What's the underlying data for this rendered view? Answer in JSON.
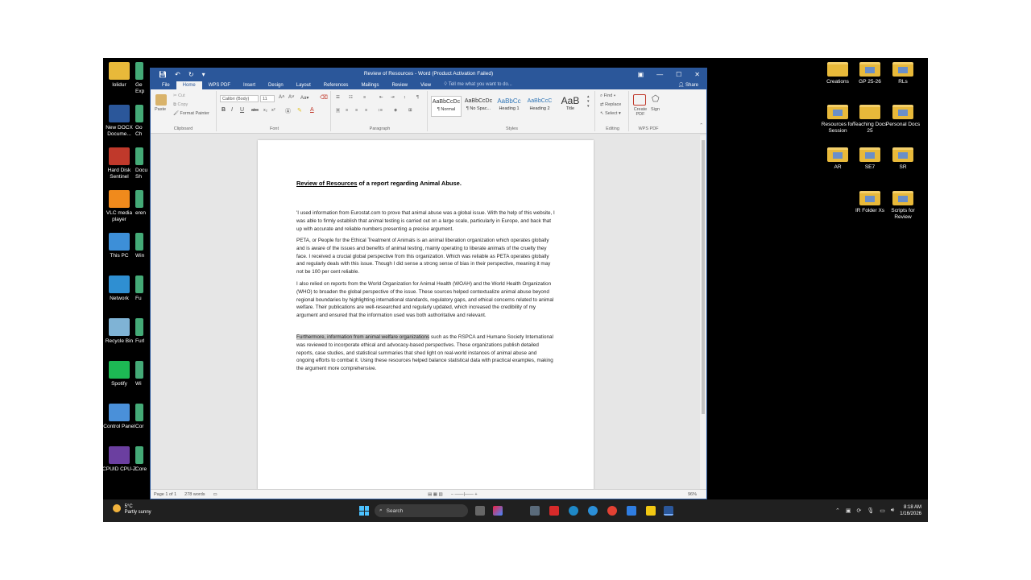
{
  "desktop_left": [
    {
      "label": "lolidur",
      "color": "#e8b93a"
    },
    {
      "label": "New DOCX Docume...",
      "color": "#2b579a"
    },
    {
      "label": "Hard Disk Sentinel",
      "color": "#c0392b"
    },
    {
      "label": "VLC media player",
      "color": "#f08a1c"
    },
    {
      "label": "This PC",
      "color": "#3d8fd8"
    },
    {
      "label": "Network",
      "color": "#2f8fd2"
    },
    {
      "label": "Recycle Bin",
      "color": "#7fb3d5"
    },
    {
      "label": "Spotify",
      "color": "#1db954"
    },
    {
      "label": "Control Panel",
      "color": "#4a90d9"
    },
    {
      "label": "CPUID CPU-Z",
      "color": "#6b3fa0"
    }
  ],
  "desktop_left_partial": [
    "Ge Exp",
    "Go Ch",
    "Docu Sh",
    "eren",
    "Win",
    "Fu",
    "Furl",
    "Wi",
    "Cor",
    "Core"
  ],
  "desktop_right": [
    {
      "label": "Creations",
      "type": "folder"
    },
    {
      "label": "GP 25-26",
      "type": "folder-doc"
    },
    {
      "label": "RLs",
      "type": "folder-doc"
    },
    {
      "label": "Resources for Session",
      "type": "folder-doc"
    },
    {
      "label": "Teaching Docs 25",
      "type": "folder"
    },
    {
      "label": "Personal Docs",
      "type": "folder-doc"
    },
    {
      "label": "AR",
      "type": "folder-doc"
    },
    {
      "label": "SE7",
      "type": "folder-doc"
    },
    {
      "label": "SR",
      "type": "folder-doc"
    },
    {
      "label": "IR Folder Xs",
      "type": "folder-doc"
    },
    {
      "label": "Scripts for Review",
      "type": "folder-doc"
    }
  ],
  "window": {
    "title": "Review of Resources - Word (Product Activation Failed)",
    "tabs": [
      "File",
      "Home",
      "WPS PDF",
      "Insert",
      "Design",
      "Layout",
      "References",
      "Mailings",
      "Review",
      "View"
    ],
    "tell_me": "Tell me what you want to do...",
    "share": "Share"
  },
  "ribbon": {
    "clipboard": {
      "label": "Clipboard",
      "paste": "Paste",
      "cut": "Cut",
      "copy": "Copy",
      "format_painter": "Format Painter"
    },
    "font": {
      "label": "Font",
      "family": "Calibri (Body)",
      "size": "11"
    },
    "paragraph": {
      "label": "Paragraph"
    },
    "styles": {
      "label": "Styles",
      "items": [
        {
          "sample": "AaBbCcDc",
          "name": "¶ Normal"
        },
        {
          "sample": "AaBbCcDc",
          "name": "¶ No Spac..."
        },
        {
          "sample": "AaBbCc",
          "name": "Heading 1"
        },
        {
          "sample": "AaBbCcC",
          "name": "Heading 2"
        },
        {
          "sample": "AaB",
          "name": "Title"
        }
      ]
    },
    "editing": {
      "label": "Editing",
      "find": "Find",
      "replace": "Replace",
      "select": "Select"
    },
    "wps": {
      "label": "WPS PDF",
      "create": "Create PDF",
      "sign": "Sign"
    }
  },
  "document": {
    "title_underlined": "Review of Resources",
    "title_rest": " of a report regarding Animal Abuse.",
    "paragraphs": [
      "'I used information from Eurostat.com to prove that animal abuse was a global issue. With the help of this website, I was able to firmly establish that animal testing is carried out on a large scale, particularly in Europe, and back that up with accurate and reliable numbers presenting a precise argument.",
      "PETA, or People for the Ethical Treatment of Animals is an animal liberation organization which operates globally and is aware of the issues and benefits of animal testing, mainly operating to liberate animals of the cruelty they face. I received a crucial global perspective from this organization. Which was reliable as PETA operates globally and regularly deals with this issue. Though I did sense a strong sense of bias in their perspective, meaning it may not be 100 per cent reliable.",
      "I also relied on reports from the World Organization for Animal Health (WOAH) and the World Health Organization (WHO) to broaden the global perspective of the issue. These sources helped contextualize animal abuse beyond regional boundaries by highlighting international standards, regulatory gaps, and ethical concerns related to animal welfare. Their publications are well-researched and regularly updated, which increased the credibility of my argument and ensured that the information used was both authoritative and relevant."
    ],
    "last_para_selected": "Furthermore, information from animal welfare organizations",
    "last_para_rest": " such as the RSPCA and Humane Society International was reviewed to incorporate ethical and advocacy-based perspectives. These organizations publish detailed reports, case studies, and statistical summaries that shed light on real-world instances of animal abuse and ongoing efforts to combat it. Using these resources helped balance statistical data with practical examples, making the argument more comprehensive."
  },
  "status": {
    "page": "Page 1 of 1",
    "words": "278 words",
    "zoom": "96%"
  },
  "taskbar": {
    "weather_temp": "5°C",
    "weather_desc": "Partly sunny",
    "search": "Search",
    "time": "8:18 AM",
    "date": "1/16/2026"
  }
}
